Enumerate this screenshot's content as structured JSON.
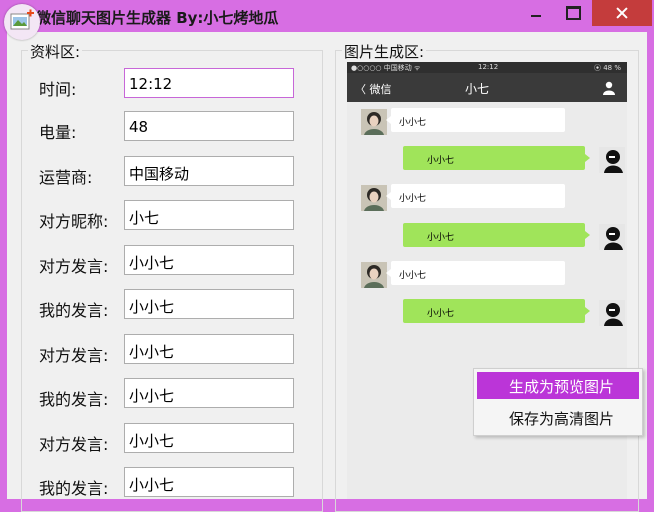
{
  "window": {
    "title": "微信聊天图片生成器 By:小七烤地瓜"
  },
  "left_panel": {
    "legend": "资料区:",
    "fields": [
      {
        "label": "时间:",
        "value": "12:12"
      },
      {
        "label": "电量:",
        "value": "48"
      },
      {
        "label": "运营商:",
        "value": "中国移动"
      },
      {
        "label": "对方昵称:",
        "value": "小七"
      },
      {
        "label": "对方发言:",
        "value": "小小七"
      },
      {
        "label": "我的发言:",
        "value": "小小七"
      },
      {
        "label": "对方发言:",
        "value": "小小七"
      },
      {
        "label": "我的发言:",
        "value": "小小七"
      },
      {
        "label": "对方发言:",
        "value": "小小七"
      },
      {
        "label": "我的发言:",
        "value": "小小七"
      }
    ]
  },
  "right_panel": {
    "legend": "图片生成区:",
    "phone": {
      "status": {
        "carrier": "●○○○○ 中国移动 ᯤ",
        "time": "12:12",
        "battery": "⦿ 48 %"
      },
      "nav": {
        "back": "〈 微信",
        "title": "小七"
      },
      "messages": [
        {
          "side": "left",
          "text": "小小七"
        },
        {
          "side": "right",
          "text": "小小七"
        },
        {
          "side": "left",
          "text": "小小七"
        },
        {
          "side": "right",
          "text": "小小七"
        },
        {
          "side": "left",
          "text": "小小七"
        },
        {
          "side": "right",
          "text": "小小七"
        }
      ]
    }
  },
  "context_menu": {
    "items": [
      {
        "label": "生成为预览图片",
        "active": true
      },
      {
        "label": "保存为高清图片",
        "active": false
      }
    ]
  },
  "colors": {
    "title_bar": "#d76ee3",
    "menu_highlight": "#bb35d8",
    "bubble_green": "#a0e45a",
    "close_button": "#c43c3c"
  }
}
